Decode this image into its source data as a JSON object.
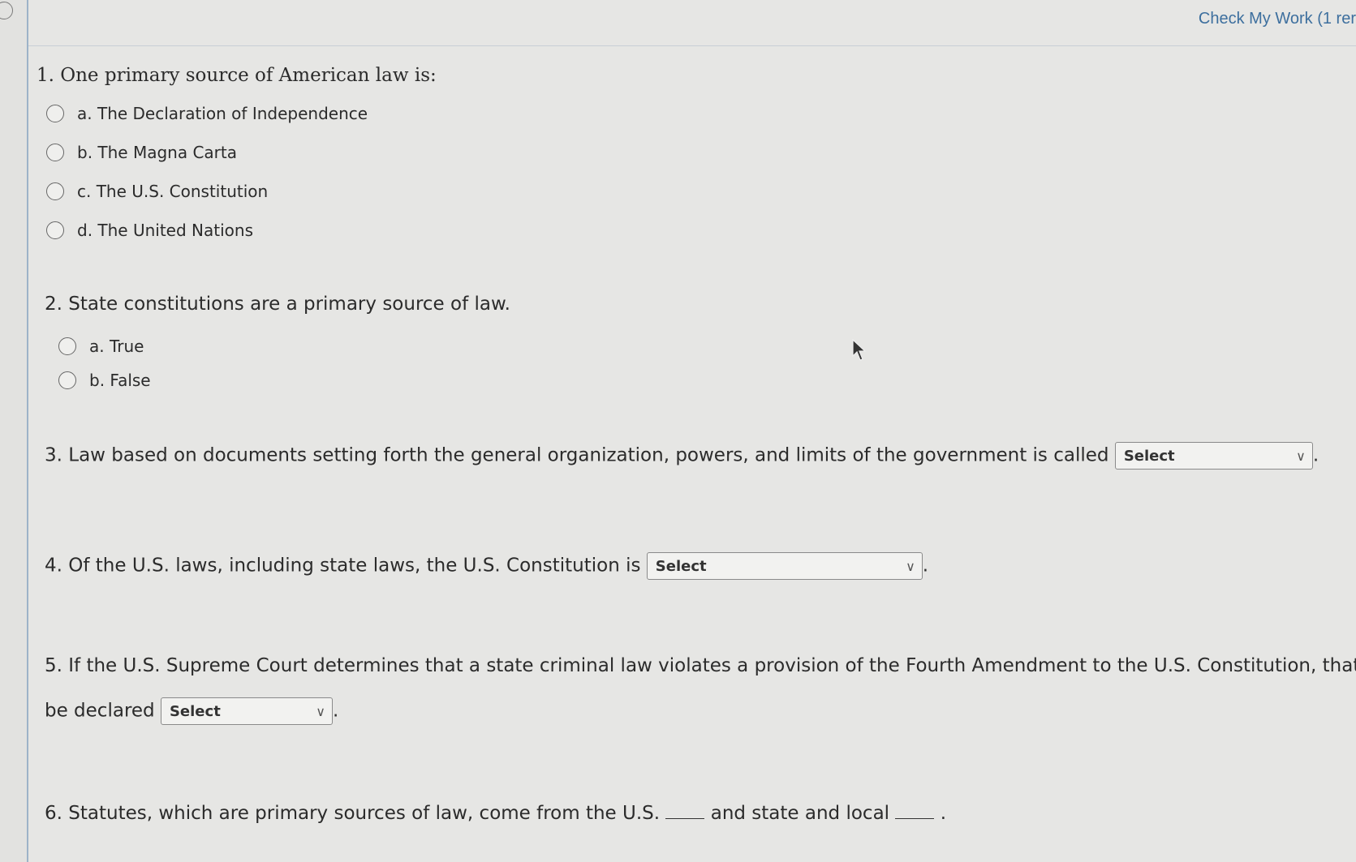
{
  "header": {
    "check_work_label": "Check My Work (1 rer"
  },
  "q1": {
    "stem": "1. One primary source of American law is:",
    "options": [
      "a. The Declaration of Independence",
      "b. The Magna Carta",
      "c. The U.S. Constitution",
      "d. The United Nations"
    ]
  },
  "q2": {
    "stem": "2. State constitutions are a primary source of law.",
    "options": [
      "a. True",
      "b. False"
    ]
  },
  "q3": {
    "stem": "3. Law based on documents setting forth the general organization, powers, and limits of the government is called",
    "select_value": "Select",
    "end": "."
  },
  "q4": {
    "stem": "4. Of the U.S. laws, including state laws, the U.S. Constitution is",
    "select_value": "Select",
    "end": "."
  },
  "q5": {
    "stem_line1": "5. If the U.S. Supreme Court determines that a state criminal law violates a provision of the Fourth Amendment to the U.S. Constitution, that l",
    "stem_line2": "be declared",
    "select_value": "Select",
    "end": "."
  },
  "q6": {
    "stem_a": "6. Statutes, which are primary sources of law, come from the U.S.",
    "stem_b": "and state and local",
    "end": "."
  },
  "icons": {
    "chevron": "chevron-down-icon",
    "cursor": "mouse-pointer-icon"
  },
  "colors": {
    "link": "#3d6f9e",
    "text": "#2b2b2b",
    "background": "#e6e6e4"
  }
}
